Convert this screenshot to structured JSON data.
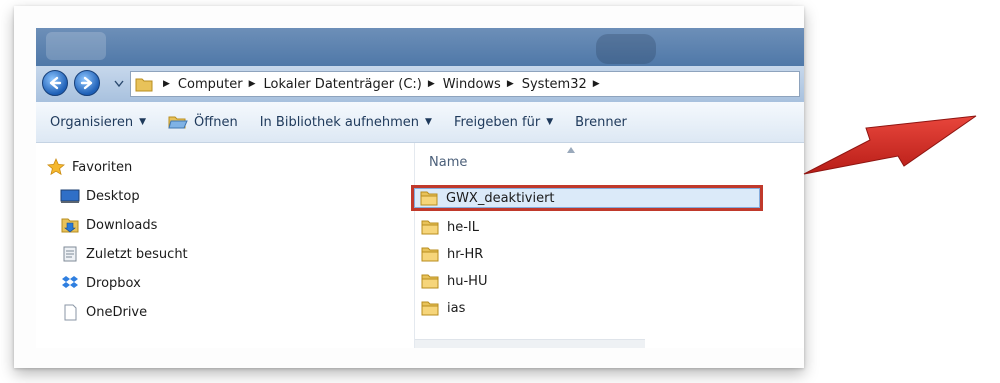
{
  "address_bar": {
    "crumbs": [
      "Computer",
      "Lokaler Datenträger (C:)",
      "Windows",
      "System32"
    ]
  },
  "toolbar": {
    "organize": "Organisieren",
    "open": "Öffnen",
    "include_library": "In Bibliothek aufnehmen",
    "share": "Freigeben für",
    "burn": "Brenner"
  },
  "nav_pane": {
    "items": [
      {
        "label": "Favoriten",
        "icon": "star-icon"
      },
      {
        "label": "Desktop",
        "icon": "desktop-icon"
      },
      {
        "label": "Downloads",
        "icon": "downloads-folder-icon"
      },
      {
        "label": "Zuletzt besucht",
        "icon": "recent-places-icon"
      },
      {
        "label": "Dropbox",
        "icon": "dropbox-icon"
      },
      {
        "label": "OneDrive",
        "icon": "onedrive-icon"
      }
    ]
  },
  "file_list": {
    "column_header": "Name",
    "rows": [
      {
        "name": "GWX_deaktiviert",
        "selected": true
      },
      {
        "name": "he-IL"
      },
      {
        "name": "hr-HR"
      },
      {
        "name": "hu-HU"
      },
      {
        "name": "ias"
      }
    ]
  },
  "colors": {
    "highlight_border": "#c0392b",
    "arrow": "#d42a22",
    "selection_fill": "#dbeaf9"
  }
}
